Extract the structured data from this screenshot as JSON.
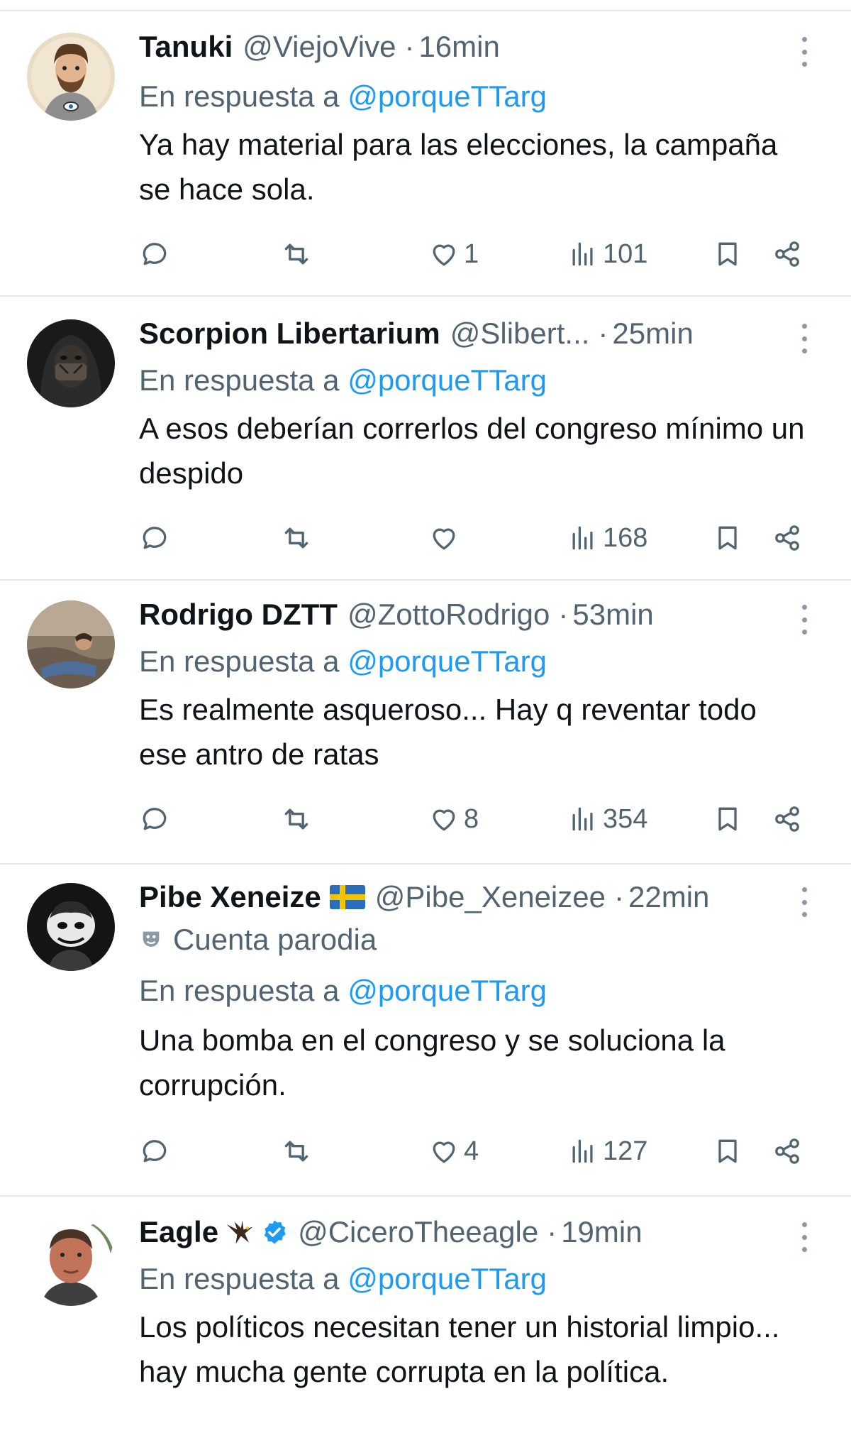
{
  "replies": [
    {
      "name": "Tanuki",
      "handle": "@ViejoVive",
      "dot": "·",
      "time": "16min",
      "reply_prefix": "En respuesta a",
      "reply_mention": "@porqueTTarg",
      "body": "Ya hay material para las elecciones, la campaña se hace sola.",
      "likes": "1",
      "views": "101",
      "avatar_icon": "cartoon-bearded-man-avatar"
    },
    {
      "name": "Scorpion Libertarium",
      "handle": "@Slibert...",
      "dot": "·",
      "time": "25min",
      "reply_prefix": "En respuesta a",
      "reply_mention": "@porqueTTarg",
      "body": "A esos deberían correrlos del congreso mínimo un despido",
      "likes": "",
      "views": "168",
      "avatar_icon": "hooded-masked-figure-avatar"
    },
    {
      "name": "Rodrigo DZTT",
      "handle": "@ZottoRodrigo",
      "dot": "·",
      "time": "53min",
      "reply_prefix": "En respuesta a",
      "reply_mention": "@porqueTTarg",
      "body": "Es realmente asqueroso... Hay q reventar todo ese antro de ratas",
      "likes": "8",
      "views": "354",
      "avatar_icon": "person-lying-photo-avatar"
    },
    {
      "name": "Pibe Xeneize",
      "handle": "@Pibe_Xeneizee",
      "dot": "·",
      "time": "22min",
      "parody_label": "Cuenta parodia",
      "reply_prefix": "En respuesta a",
      "reply_mention": "@porqueTTarg",
      "body": "Una bomba en el congreso y se soluciona la corrupción.",
      "likes": "4",
      "views": "127",
      "avatar_icon": "cartoon-character-dark-avatar",
      "flag_icon": "sweden-flag-icon"
    },
    {
      "name": "Eagle",
      "handle": "@CiceroTheeagle",
      "dot": "·",
      "time": "19min",
      "reply_prefix": "En respuesta a",
      "reply_mention": "@porqueTTarg",
      "body": "Los políticos necesitan tener un historial limpio... hay mucha gente corrupta en la política.",
      "avatar_icon": "man-portrait-avatar",
      "emoji_icon": "eagle-emoji-icon",
      "verified_icon": "verified-badge-icon"
    }
  ],
  "colors": {
    "text": "#0f1419",
    "secondary": "#536471",
    "link": "#1d9bf0",
    "divider": "#e6e9ec",
    "verified": "#1d9bf0"
  }
}
